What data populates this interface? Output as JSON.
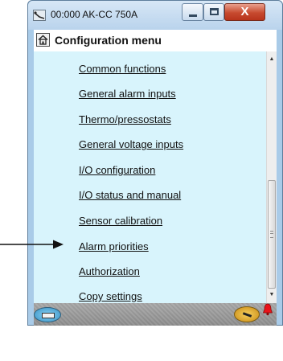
{
  "window": {
    "title": "00:000 AK-CC 750A",
    "close_symbol": "X"
  },
  "header": {
    "title": "Configuration menu"
  },
  "menu": {
    "items": [
      "Common functions",
      "General alarm inputs",
      "Thermo/pressostats",
      "General voltage inputs",
      "I/O configuration",
      "I/O status and manual",
      "Sensor calibration",
      "Alarm priorities",
      "Authorization",
      "Copy settings"
    ]
  },
  "colors": {
    "window_frame": "#a9cbe8",
    "content_background": "#d8f4fc",
    "alarm_bell": "#e8141b",
    "close_button": "#c74a2f"
  },
  "icons": {
    "app": "sensor-icon",
    "home": "home-icon",
    "keyboard": "keyboard-icon",
    "clock": "clock-icon",
    "alarm": "alarm-bell-icon",
    "annotation": "arrow-right-icon"
  }
}
